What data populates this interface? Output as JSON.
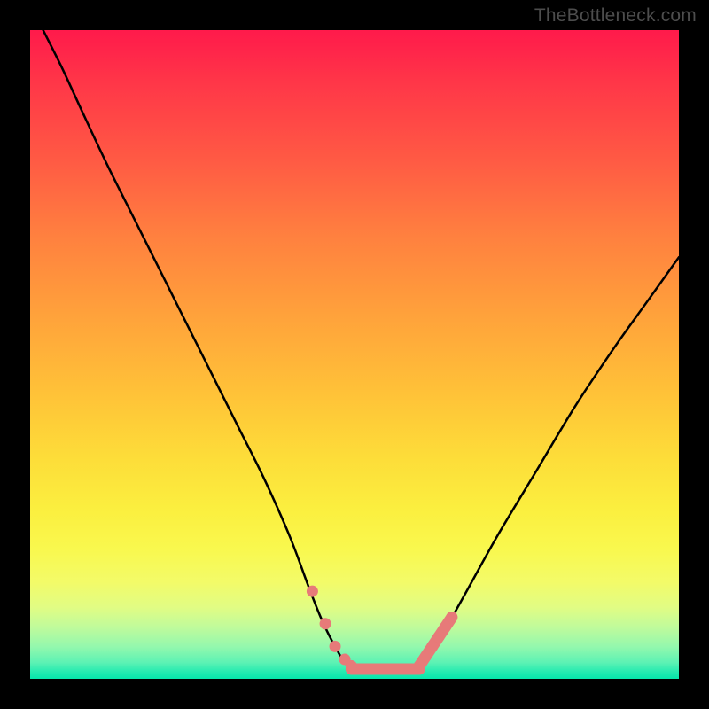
{
  "attribution": "TheBottleneck.com",
  "colors": {
    "marker": "#e77a79",
    "curve": "#000000"
  },
  "chart_data": {
    "type": "line",
    "title": "",
    "xlabel": "",
    "ylabel": "",
    "xlim": [
      0,
      100
    ],
    "ylim": [
      0,
      100
    ],
    "series": [
      {
        "name": "left-branch",
        "x": [
          2,
          5,
          8,
          12,
          16,
          20,
          24,
          28,
          32,
          36,
          40,
          43,
          45,
          47,
          49
        ],
        "y": [
          100,
          94,
          87.5,
          79,
          71,
          63,
          55,
          47,
          39,
          31,
          22,
          14,
          9,
          5,
          2
        ]
      },
      {
        "name": "plateau",
        "x": [
          49,
          52,
          56,
          60
        ],
        "y": [
          2,
          1,
          1,
          2
        ]
      },
      {
        "name": "right-branch",
        "x": [
          60,
          63,
          67,
          72,
          78,
          84,
          90,
          95,
          100
        ],
        "y": [
          2,
          6,
          13,
          22,
          32,
          42,
          51,
          58,
          65
        ]
      },
      {
        "name": "markers-left",
        "kind": "scatter",
        "x": [
          43.5,
          45.5,
          47,
          48.5,
          49.5
        ],
        "y": [
          13.5,
          8.5,
          5,
          3,
          2
        ]
      },
      {
        "name": "markers-right",
        "kind": "scatter",
        "x": [
          60,
          61,
          62,
          63,
          64,
          65
        ],
        "y": [
          2,
          3.5,
          5,
          6.5,
          8,
          9.5
        ]
      }
    ],
    "plateau_bar": {
      "x0": 49.5,
      "x1": 60,
      "y": 1.5
    }
  }
}
